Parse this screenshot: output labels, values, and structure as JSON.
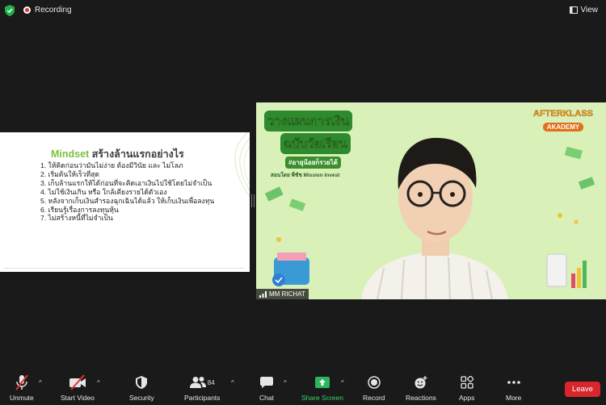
{
  "topbar": {
    "recording_label": "Recording",
    "view_label": "View"
  },
  "slide": {
    "title_en": "Mindset",
    "title_th": " สร้างล้านแรกอย่างไร",
    "items": [
      "1. ให้คิดก่อนว่ามันไม่ง่าย ต้องมีวินัย และ ไม่โลภ",
      "2. เริ่มต้นให้เร็วที่สุด",
      "3. เก็บล้านแรกให้ได้ก่อนที่จะคิดเอาเงินไปใช้โดยไม่จำเป็น",
      "4. ไม่ใช้เงินเกิน หรือ ใกล้เคียงรายได้ตัวเอง",
      "5. หลังจากเก็บเงินสำรองฉุกเฉินได้แล้ว ให้เก็บเงินเพื่อลงทุน",
      "6. เรียนรู้เรื่องการลงทุนหุ้น",
      "7. ไม่สร้างหนี้ที่ไม่จำเป็น"
    ]
  },
  "video": {
    "banner_line1": "วางแผนการเงิน",
    "banner_line2": "ฉบับวัยเรียน",
    "banner_sub": "#อายุน้อยก็รวยได้",
    "banner_by": "สอนโดย พี่ชัช Mission Invest",
    "logo_top": "AFTERKLASS",
    "logo_bottom": "AKADEMY",
    "participant_name": "MM RICHAT"
  },
  "toolbar": {
    "unmute": "Unmute",
    "start_video": "Start Video",
    "security": "Security",
    "participants": "Participants",
    "participants_count": "84",
    "chat": "Chat",
    "share_screen": "Share Screen",
    "record": "Record",
    "reactions": "Reactions",
    "apps": "Apps",
    "more": "More",
    "leave": "Leave"
  },
  "colors": {
    "leave_red": "#d9262c",
    "share_green": "#3bd26b",
    "slide_green": "#7fbf3f"
  }
}
